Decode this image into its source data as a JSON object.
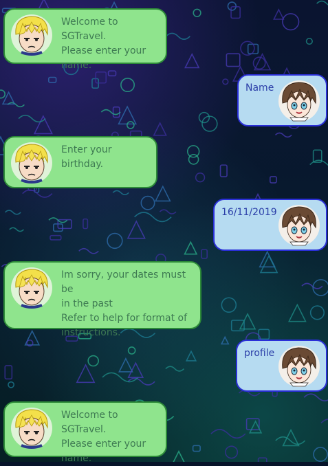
{
  "messages": [
    {
      "sender": "bot",
      "avatar": "blonde-character-avatar",
      "text": "Welcome to SGTravel.\n Please enter your\nname."
    },
    {
      "sender": "user",
      "avatar": "brown-haired-character-avatar",
      "text": "Name"
    },
    {
      "sender": "bot",
      "avatar": "blonde-character-avatar",
      "text": "Enter your birthday."
    },
    {
      "sender": "user",
      "avatar": "brown-haired-character-avatar",
      "text": "16/11/2019"
    },
    {
      "sender": "bot",
      "avatar": "blonde-character-avatar",
      "text": "Im sorry, your dates must be\nin the past\nRefer to help for format of\ninstructions."
    },
    {
      "sender": "user",
      "avatar": "brown-haired-character-avatar",
      "text": "profile"
    },
    {
      "sender": "bot",
      "avatar": "blonde-character-avatar",
      "text": "Welcome to SGTravel.\n Please enter your\nname."
    }
  ],
  "colors": {
    "bot_bubble": "#8fe48d",
    "bot_border": "#2d8a38",
    "bot_text": "#3e7a52",
    "user_bubble": "#b6dbf1",
    "user_border": "#2a2fd8",
    "user_text": "#2b3ea8"
  }
}
